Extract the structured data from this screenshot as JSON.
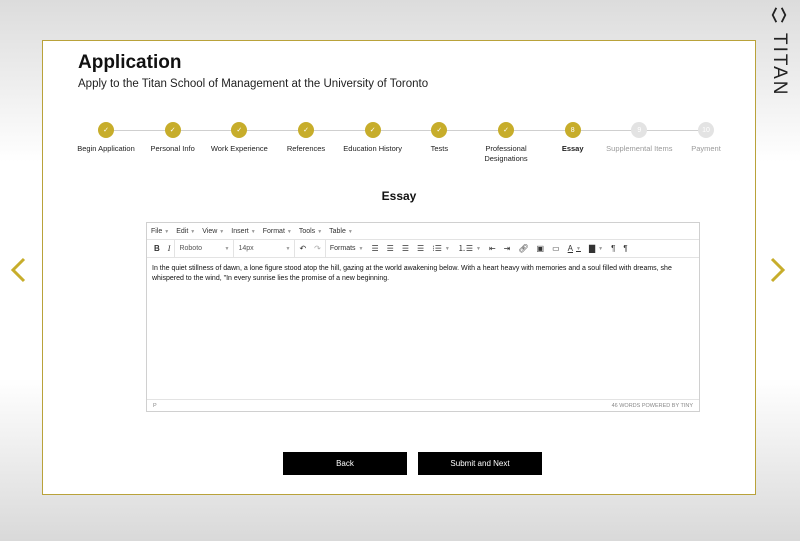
{
  "brand": {
    "name": "TITAN",
    "logo_icon": "hexagon-outline-icon"
  },
  "nav": {
    "prev_icon": "chevron-left-icon",
    "next_icon": "chevron-right-icon",
    "accent": "#c7ad2b"
  },
  "header": {
    "title": "Application",
    "subtitle": "Apply to the Titan School of Management at the University of Toronto"
  },
  "steps": [
    {
      "label": "Begin Application",
      "status": "done",
      "marker": "✓"
    },
    {
      "label": "Personal Info",
      "status": "done",
      "marker": "✓"
    },
    {
      "label": "Work Experience",
      "status": "done",
      "marker": "✓"
    },
    {
      "label": "References",
      "status": "done",
      "marker": "✓"
    },
    {
      "label": "Education History",
      "status": "done",
      "marker": "✓"
    },
    {
      "label": "Tests",
      "status": "done",
      "marker": "✓"
    },
    {
      "label": "Professional Designations",
      "status": "done",
      "marker": "✓"
    },
    {
      "label": "Essay",
      "status": "current",
      "marker": "8"
    },
    {
      "label": "Supplemental Items",
      "status": "todo",
      "marker": "9"
    },
    {
      "label": "Payment",
      "status": "todo",
      "marker": "10"
    }
  ],
  "section": {
    "heading": "Essay"
  },
  "editor": {
    "menus": [
      "File",
      "Edit",
      "View",
      "Insert",
      "Format",
      "Tools",
      "Table"
    ],
    "font_family": "Roboto",
    "font_size": "14px",
    "formats_label": "Formats",
    "content": "In the quiet stillness of dawn, a lone figure stood atop the hill, gazing at the world awakening below. With a heart heavy with memories and a soul filled with dreams, she whispered to the wind, \"In every sunrise lies the promise of a new beginning.",
    "status_path": "P",
    "word_count": "46 WORDS POWERED BY TINY"
  },
  "actions": {
    "back_label": "Back",
    "next_label": "Submit and Next"
  }
}
